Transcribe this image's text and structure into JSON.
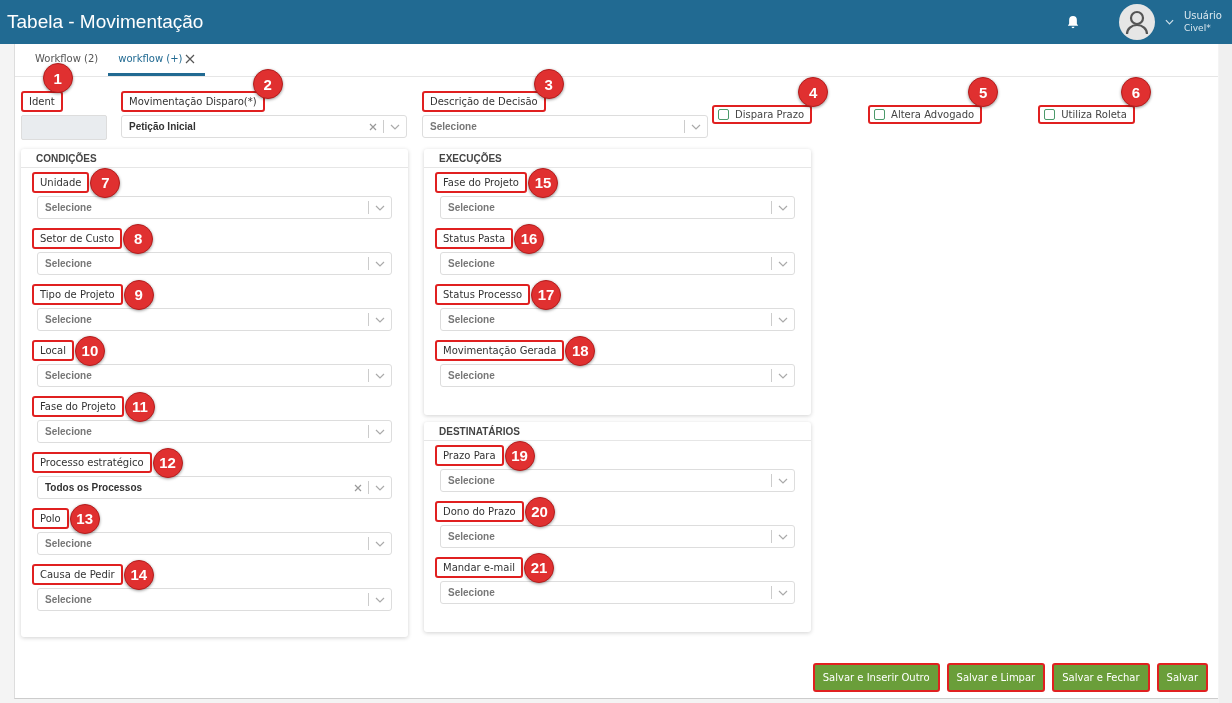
{
  "window": {
    "title": "Tabela - Movimentação"
  },
  "user": {
    "name": "Usuário",
    "profile": "Civel*"
  },
  "tabs": [
    {
      "label": "Workflow (2)",
      "selected": false,
      "closable": false
    },
    {
      "label": "workflow (+)",
      "selected": true,
      "closable": true
    }
  ],
  "top_fields": [
    {
      "kind": "text",
      "label": "Ident",
      "callout": "1",
      "disabled": true
    },
    {
      "kind": "select",
      "label": "Movimentação Disparo(*)",
      "callout": "2",
      "value": "Petição Inicial",
      "clearable": true
    },
    {
      "kind": "select",
      "label": "Descrição de Decisão",
      "callout": "3",
      "placeholder": "Selecione",
      "clearable": false
    },
    {
      "kind": "checkbox",
      "label": "Dispara Prazo",
      "callout": "4",
      "checked": false
    },
    {
      "kind": "checkbox",
      "label": "Altera Advogado",
      "callout": "5",
      "checked": false
    },
    {
      "kind": "checkbox",
      "label": "Utiliza Roleta",
      "callout": "6",
      "checked": false
    }
  ],
  "panels": [
    {
      "title": "CONDIÇÕES",
      "fields": [
        {
          "label": "Unidade",
          "callout": "7",
          "placeholder": "Selecione",
          "clearable": false
        },
        {
          "label": "Setor de Custo",
          "callout": "8",
          "placeholder": "Selecione",
          "clearable": false
        },
        {
          "label": "Tipo de Projeto",
          "callout": "9",
          "placeholder": "Selecione",
          "clearable": false
        },
        {
          "label": "Local",
          "callout": "10",
          "placeholder": "Selecione",
          "clearable": false
        },
        {
          "label": "Fase do Projeto",
          "callout": "11",
          "placeholder": "Selecione",
          "clearable": false
        },
        {
          "label": "Processo estratégico",
          "callout": "12",
          "value": "Todos os Processos",
          "clearable": true
        },
        {
          "label": "Polo",
          "callout": "13",
          "placeholder": "Selecione",
          "clearable": false
        },
        {
          "label": "Causa de Pedir",
          "callout": "14",
          "placeholder": "Selecione",
          "clearable": false
        }
      ]
    },
    {
      "title": "EXECUÇÕES",
      "fields": [
        {
          "label": "Fase do Projeto",
          "callout": "15",
          "placeholder": "Selecione",
          "clearable": false
        },
        {
          "label": "Status Pasta",
          "callout": "16",
          "placeholder": "Selecione",
          "clearable": false
        },
        {
          "label": "Status Processo",
          "callout": "17",
          "placeholder": "Selecione",
          "clearable": false
        },
        {
          "label": "Movimentação Gerada",
          "callout": "18",
          "placeholder": "Selecione",
          "clearable": false
        }
      ]
    },
    {
      "title": "DESTINATÁRIOS",
      "fields": [
        {
          "label": "Prazo Para",
          "callout": "19",
          "placeholder": "Selecione",
          "clearable": false
        },
        {
          "label": "Dono do Prazo",
          "callout": "20",
          "placeholder": "Selecione",
          "clearable": false
        },
        {
          "label": "Mandar e-mail",
          "callout": "21",
          "placeholder": "Selecione",
          "clearable": false
        }
      ]
    }
  ],
  "buttons": [
    {
      "label": "Salvar e Inserir Outro",
      "highlighted": true
    },
    {
      "label": "Salvar e Limpar",
      "highlighted": true
    },
    {
      "label": "Salvar e Fechar",
      "highlighted": true
    },
    {
      "label": "Salvar",
      "highlighted": true
    }
  ]
}
